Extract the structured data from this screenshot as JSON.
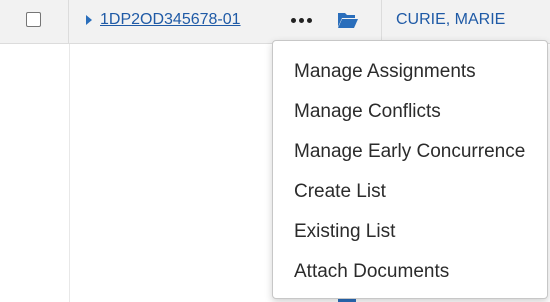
{
  "row": {
    "grant_number": "1DP2OD345678-01",
    "pi_name": "CURIE, MARIE"
  },
  "icons": {
    "expand": "caret-right-icon",
    "more": "ellipsis-icon",
    "folder": "folder-open-icon"
  },
  "menu": {
    "items": [
      "Manage Assignments",
      "Manage Conflicts",
      "Manage Early Concurrence",
      "Create List",
      "Existing List",
      "Attach Documents"
    ]
  },
  "colors": {
    "link": "#1f5aa6",
    "icon_blue": "#2a6ebb",
    "row_bg": "#f2f2f2"
  }
}
